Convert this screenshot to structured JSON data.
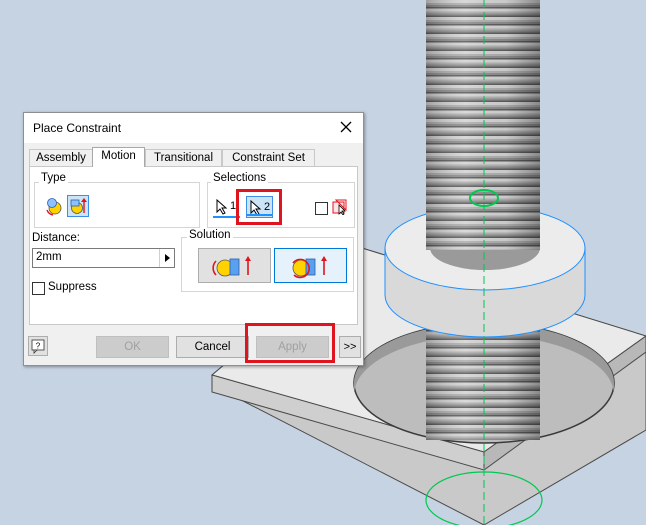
{
  "dialog": {
    "title": "Place Constraint",
    "tabs": [
      {
        "label": "Assembly",
        "active": false
      },
      {
        "label": "Motion",
        "active": true
      },
      {
        "label": "Transitional",
        "active": false
      },
      {
        "label": "Constraint Set",
        "active": false
      }
    ],
    "type_label": "Type",
    "selections_label": "Selections",
    "selection_1": "1",
    "selection_2": "2",
    "distance_label": "Distance:",
    "distance_value": "2mm",
    "suppress_label": "Suppress",
    "solution_label": "Solution",
    "buttons": {
      "ok": "OK",
      "cancel": "Cancel",
      "apply": "Apply",
      "more": ">>"
    }
  },
  "colors": {
    "highlight_red": "#e0141e",
    "viewport_bg": "#c6d3e2",
    "selection_blue": "#1e90ff",
    "axis_green": "#00c850"
  },
  "icons": [
    "close-icon",
    "help-icon",
    "rotation-icon",
    "rotation-translation-icon",
    "select-first-icon",
    "select-second-icon",
    "pick-part-first-icon",
    "forward-solution-icon",
    "backward-solution-icon",
    "dropdown-arrow-icon"
  ]
}
